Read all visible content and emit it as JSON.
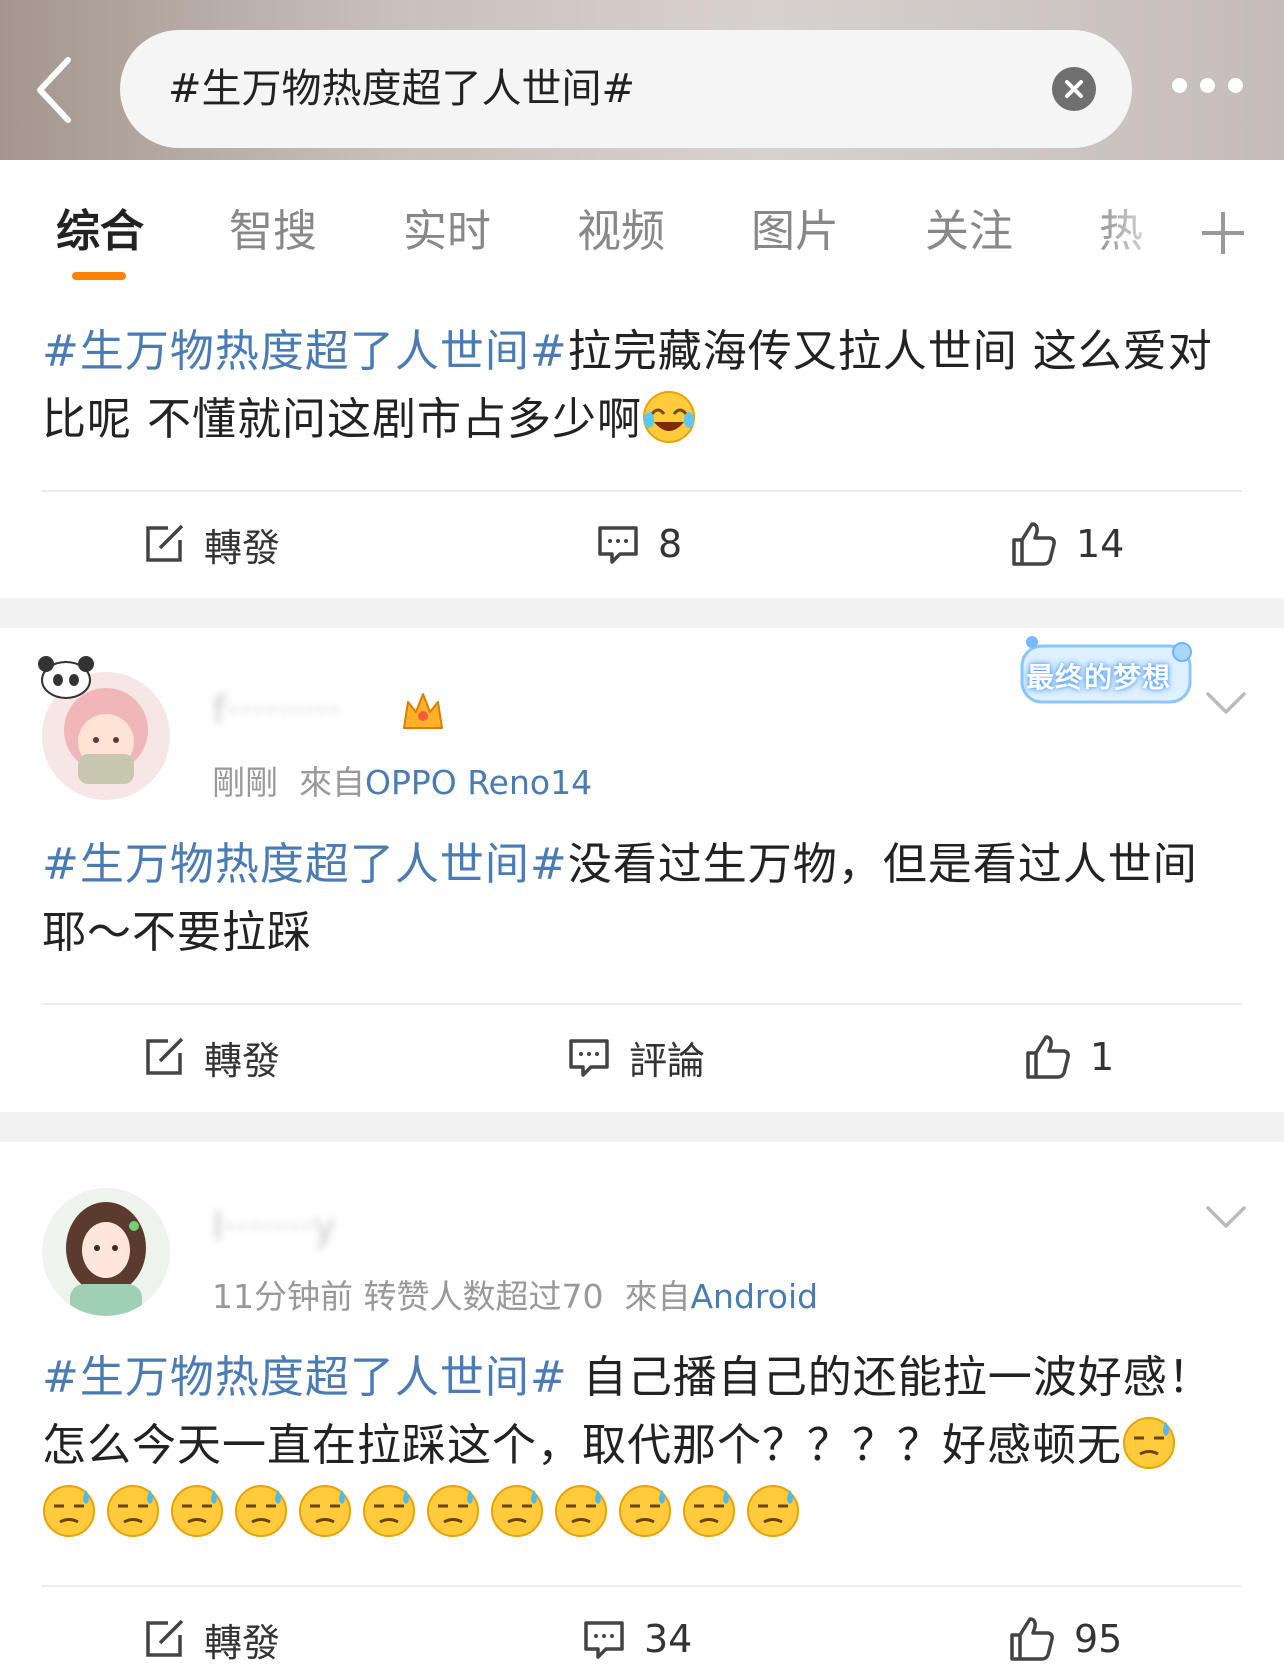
{
  "search": {
    "query": "#生万物热度超了人世间#"
  },
  "tabs": [
    {
      "label": "综合"
    },
    {
      "label": "智搜"
    },
    {
      "label": "实时"
    },
    {
      "label": "视频"
    },
    {
      "label": "图片"
    },
    {
      "label": "关注"
    },
    {
      "label": "热"
    }
  ],
  "posts": [
    {
      "hashtag": "#生万物热度超了人世间#",
      "text": "拉完藏海传又拉人世间 这么爱对比呢 不懂就问这剧市占多少啊",
      "emoji": "laughing-crying-emoji",
      "repost_label": "轉發",
      "comment_label": "8",
      "like_count": "14"
    },
    {
      "username": "f·········",
      "time": "剛剛",
      "source_prefix": "來自",
      "source": "OPPO Reno14",
      "badge": "最终的梦想",
      "hashtag": "#生万物热度超了人世间#",
      "text": "没看过生万物，但是看过人世间耶～不要拉踩",
      "repost_label": "轉發",
      "comment_label": "評論",
      "like_count": "1"
    },
    {
      "username": "I·······y",
      "time": "11分钟前",
      "extra": "转赞人数超过70",
      "source_prefix": "來自",
      "source": "Android",
      "hashtag": "#生万物热度超了人世间#",
      "text": " 自己播自己的还能拉一波好感！怎么今天一直在拉踩这个，取代那个？？？？好感顿无",
      "emoji": "sweat-emoji",
      "emoji_count": 13,
      "repost_label": "轉發",
      "comment_label": "34",
      "like_count": "95"
    }
  ]
}
